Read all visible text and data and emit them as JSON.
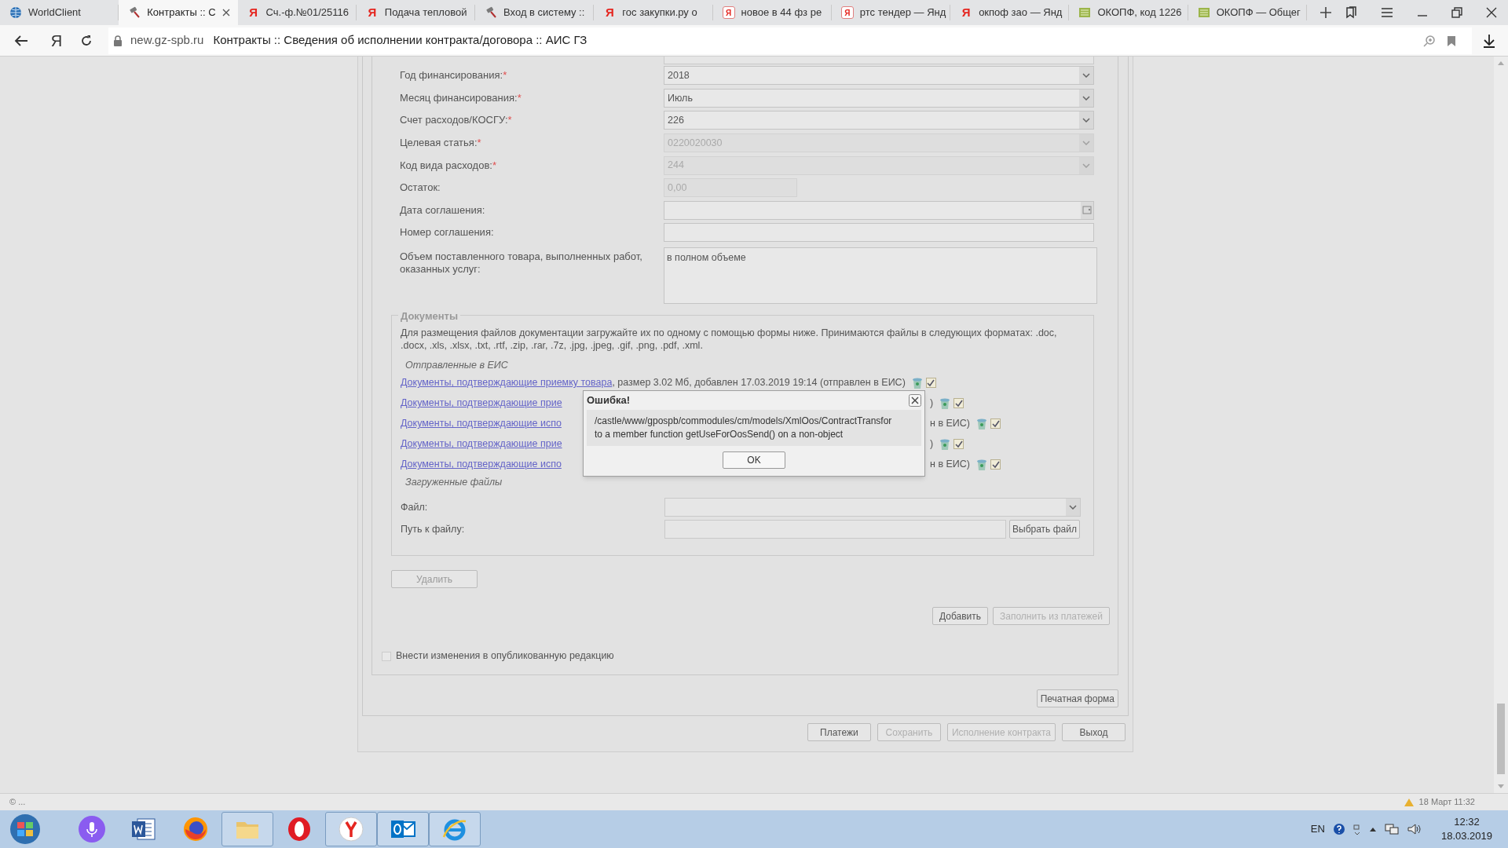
{
  "browser": {
    "tabs": [
      {
        "label": "WorldClient",
        "kind": "globe",
        "selected": false
      },
      {
        "label": "Контракты :: С",
        "kind": "gavel",
        "selected": true
      },
      {
        "label": "Сч.-ф.№01/25116",
        "kind": "ya",
        "icon_text": "Я",
        "selected": false
      },
      {
        "label": "Подача тепловой",
        "kind": "ya",
        "icon_text": "Я",
        "selected": false
      },
      {
        "label": "Вход в систему ::",
        "kind": "gavel",
        "selected": false
      },
      {
        "label": "гос закупки.ру о",
        "kind": "ya",
        "icon_text": "Я",
        "selected": false
      },
      {
        "label": "новое в 44 фз ре",
        "kind": "yabox",
        "icon_text": "Я",
        "selected": false
      },
      {
        "label": "ртс тендер — Янд",
        "kind": "yabox",
        "icon_text": "Я",
        "selected": false
      },
      {
        "label": "окпоф зао — Янд",
        "kind": "ya",
        "icon_text": "Я",
        "selected": false
      },
      {
        "label": "ОКОПФ, код 1226",
        "kind": "sheet",
        "selected": false
      },
      {
        "label": "ОКОПФ — Общег",
        "kind": "sheet",
        "selected": false
      }
    ],
    "home_glyph": "Я",
    "address": {
      "domain": "new.gz-spb.ru",
      "title": "Контракты :: Сведения об исполнении контракта/договора :: АИС ГЗ"
    }
  },
  "form": {
    "fields": [
      {
        "label": "Год финансирования:",
        "marker": "*",
        "kind": "select",
        "value": "2018",
        "disabled": false
      },
      {
        "label": "Месяц финансирования:",
        "marker": "*",
        "kind": "select",
        "value": "Июль",
        "disabled": false
      },
      {
        "label": "Счет расходов/КОСГУ:",
        "marker": "*",
        "kind": "select",
        "value": "226",
        "disabled": false
      },
      {
        "label": "Целевая статья:",
        "marker": "*",
        "kind": "select",
        "value": "0220020030",
        "disabled": true
      },
      {
        "label": "Код вида расходов:",
        "marker": "*",
        "kind": "select",
        "value": "244",
        "disabled": true
      },
      {
        "label": "Остаток:",
        "kind": "short",
        "value": "0,00",
        "disabled": true
      },
      {
        "label": "Дата соглашения:",
        "kind": "date",
        "disabled": false
      },
      {
        "label": "Номер соглашения:",
        "kind": "text",
        "disabled": false
      },
      {
        "label": "Объем поставленного товара, выполненных работ, оказанных услуг:",
        "kind": "textarea",
        "value": "в полном объеме",
        "disabled": false
      }
    ]
  },
  "documents": {
    "legend": "Документы",
    "description": "Для размещения файлов документации загружайте их по одному с помощью формы ниже. Принимаются файлы в следующих форматах: .doc, .docx, .xls, .xlsx, .txt, .rtf, .zip, .rar, .7z, .jpg, .jpeg, .gif, .png, .pdf, .xml.",
    "sent_heading": "Отправленные в ЕИС",
    "files": [
      {
        "link": "Документы, подтверждающие приемку товара",
        "details": ", размер 3.02 Мб, добавлен 17.03.2019 19:14 (отправлен в ЕИС)",
        "checked": true
      },
      {
        "link": "Документы, подтверждающие прие",
        "tail": ")",
        "checked": true
      },
      {
        "link": "Документы, подтверждающие испо",
        "tail": "н в ЕИС)",
        "checked": true
      },
      {
        "link": "Документы, подтверждающие прие",
        "tail": ")",
        "checked": true
      },
      {
        "link": "Документы, подтверждающие испо",
        "tail": "н в ЕИС)",
        "checked": true
      }
    ],
    "uploaded_heading": "Загруженные файлы",
    "file_label": "Файл:",
    "path_label": "Путь к файлу:",
    "choose_button": "Выбрать файл"
  },
  "delete_button": "Удалить",
  "add_buttons": [
    {
      "label": "Добавить",
      "disabled": false
    },
    {
      "label": "Заполнить из платежей",
      "disabled": true
    }
  ],
  "publish_checkbox": {
    "label": "Внести изменения в опубликованную редакцию",
    "checked": false
  },
  "print_button": "Печатная форма",
  "footer_buttons": [
    {
      "label": "Платежи",
      "disabled": false
    },
    {
      "label": "Сохранить",
      "disabled": true
    },
    {
      "label": "Исполнение контракта",
      "disabled": true
    },
    {
      "label": "Выход",
      "disabled": false
    }
  ],
  "dialog": {
    "title": "Ошибка!",
    "lines": [
      "/castle/www/gpospb/commodules/cm/models/XmlOos/ContractTransfor",
      "to a member function getUseForOosSend() on a non-object"
    ],
    "ok": "OK"
  },
  "status_bar": {
    "left": "© ...",
    "right": "18 Март 11:32"
  },
  "taskbar": {
    "apps": [
      {
        "kind": "mic"
      },
      {
        "kind": "word"
      },
      {
        "kind": "firefox"
      },
      {
        "kind": "folder"
      },
      {
        "kind": "opera"
      },
      {
        "kind": "yandex"
      },
      {
        "kind": "outlook"
      },
      {
        "kind": "ie"
      }
    ],
    "language": "EN",
    "time": "12:32",
    "date": "18.03.2019"
  }
}
